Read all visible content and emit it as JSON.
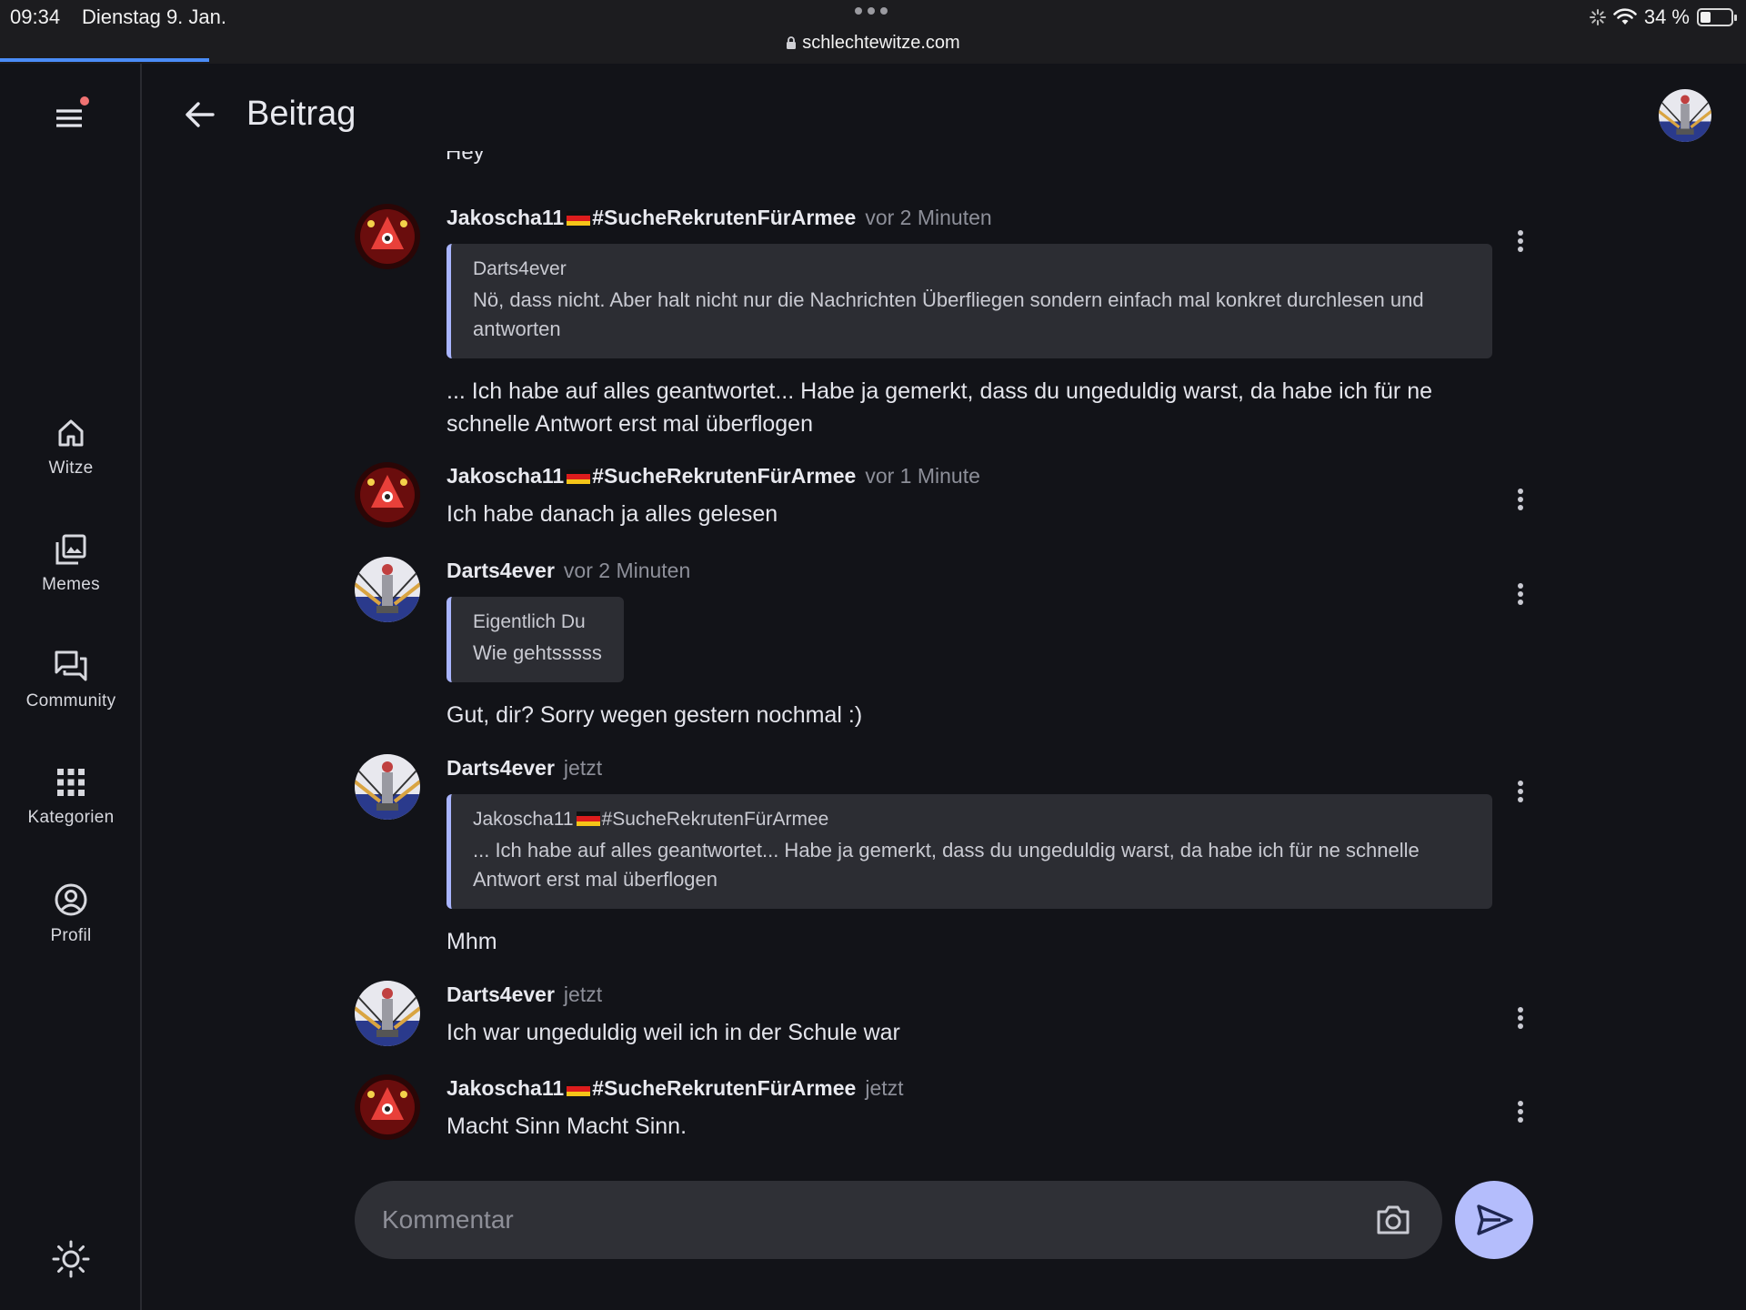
{
  "status_bar": {
    "time": "09:34",
    "date": "Dienstag 9. Jan.",
    "url": "schlechtewitze.com",
    "battery": "34 %",
    "battery_level": 0.34
  },
  "sidebar": {
    "items": [
      {
        "label": "Witze",
        "icon": "home-icon"
      },
      {
        "label": "Memes",
        "icon": "image-gallery-icon"
      },
      {
        "label": "Community",
        "icon": "chat-icon"
      },
      {
        "label": "Kategorien",
        "icon": "grid-icon"
      },
      {
        "label": "Profil",
        "icon": "account-circle-icon"
      }
    ]
  },
  "header": {
    "title": "Beitrag"
  },
  "partial_message": "Hey",
  "messages": [
    {
      "author": "Jakoscha11",
      "tag": "#SucheRekrutenFürArmee",
      "time": "vor 2 Minuten",
      "quote": {
        "author": "Darts4ever",
        "text": "Nö, dass nicht. Aber halt nicht nur die Nachrichten Überfliegen sondern einfach mal konkret durchlesen und antworten"
      },
      "text": "... Ich habe auf alles geantwortet... Habe ja gemerkt, dass du ungeduldig warst, da habe ich für ne schnelle Antwort erst mal überflogen"
    },
    {
      "author": "Jakoscha11",
      "tag": "#SucheRekrutenFürArmee",
      "time": "vor 1 Minute",
      "text": "Ich habe danach ja alles gelesen"
    },
    {
      "author": "Darts4ever",
      "time": "vor 2 Minuten",
      "quote": {
        "author": "Eigentlich Du",
        "text": "Wie gehtsssss"
      },
      "text": "Gut, dir? Sorry wegen gestern nochmal :)"
    },
    {
      "author": "Darts4ever",
      "time": "jetzt",
      "quote": {
        "author": "Jakoscha11",
        "tag": "#SucheRekrutenFürArmee",
        "text": "... Ich habe auf alles geantwortet... Habe ja gemerkt, dass du ungeduldig warst, da habe ich für ne schnelle Antwort erst mal überflogen"
      },
      "text": "Mhm"
    },
    {
      "author": "Darts4ever",
      "time": "jetzt",
      "text": "Ich war ungeduldig weil ich in der Schule war"
    },
    {
      "author": "Jakoscha11",
      "tag": "#SucheRekrutenFürArmee",
      "time": "jetzt",
      "text": "Macht Sinn Macht Sinn."
    }
  ],
  "comment": {
    "placeholder": "Kommentar",
    "value": ""
  },
  "colors": {
    "background": "#121318",
    "accent": "#b4bdfc",
    "quote_border": "#a9b5ff",
    "notification_dot": "#f07272",
    "loading_bar": "#4a8cf7"
  }
}
